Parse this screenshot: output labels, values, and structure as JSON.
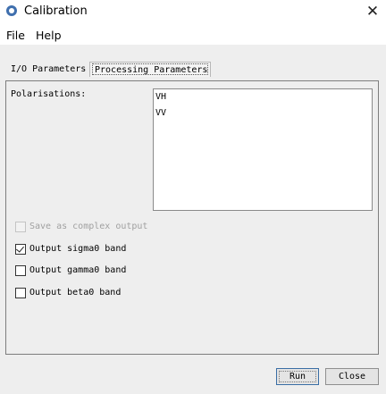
{
  "window": {
    "title": "Calibration",
    "app_icon": "snap-globe-icon",
    "close_glyph": "✕"
  },
  "menu": {
    "items": [
      "File",
      "Help"
    ]
  },
  "tabs": [
    {
      "label": "I/O Parameters",
      "active": false
    },
    {
      "label": "Processing Parameters",
      "active": true
    }
  ],
  "processing": {
    "polarisations_label": "Polarisations:",
    "polarisations": [
      "VH",
      "VV"
    ],
    "options": [
      {
        "label": "Save as complex output",
        "checked": false,
        "enabled": false
      },
      {
        "label": "Output sigma0 band",
        "checked": true,
        "enabled": true
      },
      {
        "label": "Output gamma0 band",
        "checked": false,
        "enabled": true
      },
      {
        "label": "Output beta0 band",
        "checked": false,
        "enabled": true
      }
    ]
  },
  "buttons": {
    "run": "Run",
    "close": "Close"
  }
}
